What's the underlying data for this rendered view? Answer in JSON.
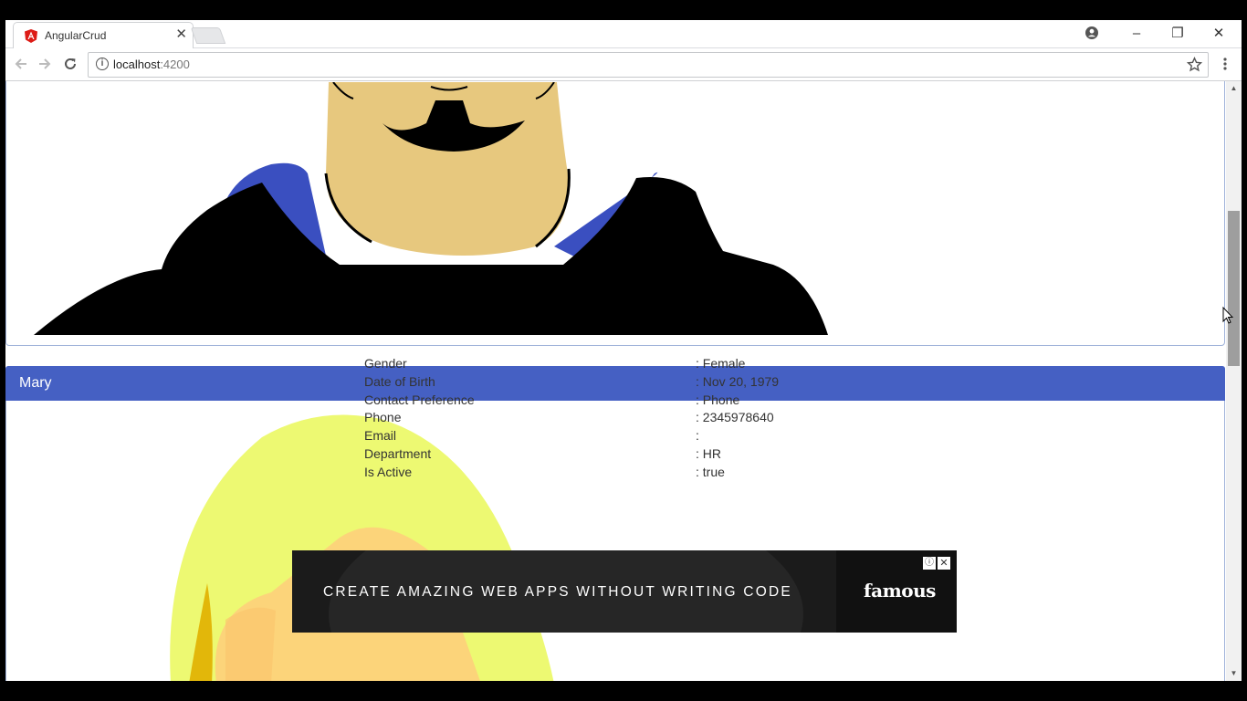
{
  "browser": {
    "tab_title": "AngularCrud",
    "tab_close": "✕",
    "url_host": "localhost",
    "url_port": ":4200",
    "info_glyph": "i",
    "icons": [
      "back-icon",
      "forward-icon",
      "reload-icon",
      "info-icon",
      "star-icon",
      "menu-icon",
      "account-icon",
      "minimize-icon",
      "restore-icon",
      "close-icon"
    ]
  },
  "window_controls": {
    "minimize": "–",
    "restore": "❐",
    "close": "✕"
  },
  "employee": {
    "name": "Mary",
    "details": [
      {
        "label": "Gender",
        "value": ": Female"
      },
      {
        "label": "Date of Birth",
        "value": ": Nov 20, 1979"
      },
      {
        "label": "Contact Preference",
        "value": ": Phone"
      },
      {
        "label": "Phone",
        "value": ": 2345978640"
      },
      {
        "label": "Email",
        "value": ":"
      },
      {
        "label": "Department",
        "value": ": HR"
      },
      {
        "label": "Is Active",
        "value": ": true"
      }
    ]
  },
  "ad": {
    "text": "CREATE AMAZING WEB APPS WITHOUT WRITING CODE",
    "brand": "famous",
    "info_glyph": "ⓘ",
    "close_glyph": "✕"
  },
  "colors": {
    "header_blue": "#4560c3",
    "panel_border": "#9fb2d9"
  }
}
